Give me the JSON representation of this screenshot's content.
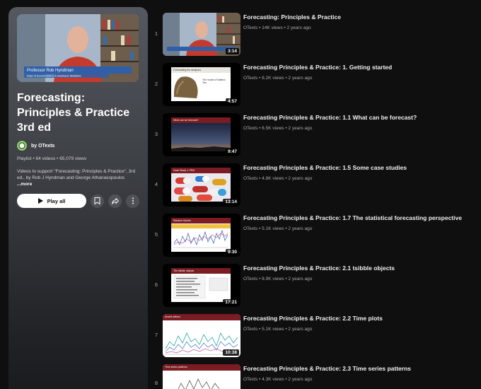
{
  "playlist": {
    "thumb_caption_line1": "Professor Rob Hyndman",
    "thumb_caption_line2": "Dept of Econometrics & Business Statistics",
    "title": "Forecasting: Principles & Practice 3rd ed",
    "owner": "by OTexts",
    "stats": "Playlist • 64 videos • 65,079 views",
    "description": "Videos to support \"Forecasting: Principles & Practice\", 3rd ed., by Rob J Hyndman and George Athanasopoulos",
    "more_label": "...more",
    "play_all_label": "Play all"
  },
  "videos": [
    {
      "index": "1",
      "title": "Forecasting: Principles & Practice",
      "meta": "OTexts • 14K views • 2 years ago",
      "duration": "3:14"
    },
    {
      "index": "2",
      "title": "Forecasting Principles & Practice: 1. Getting started",
      "meta": "OTexts • 8.2K views • 2 years ago",
      "duration": "4:57",
      "slide_title": "Forecasting the weapons",
      "slide_text": "The model of Watts's Tea"
    },
    {
      "index": "3",
      "title": "Forecasting Principles & Practice: 1.1 What can be forecast?",
      "meta": "OTexts • 6.5K views • 2 years ago",
      "duration": "9:47",
      "slide_title": "What can we forecast?"
    },
    {
      "index": "4",
      "title": "Forecasting Principles & Practice: 1.5 Some case studies",
      "meta": "OTexts • 4.8K views • 2 years ago",
      "duration": "13:14",
      "slide_title": "Case Study 1: PBS"
    },
    {
      "index": "5",
      "title": "Forecasting Principles & Practice: 1.7 The statistical forecasting perspective",
      "meta": "OTexts • 5.1K views • 2 years ago",
      "duration": "9:30",
      "slide_title": "Random futures"
    },
    {
      "index": "6",
      "title": "Forecasting Principles & Practice: 2.1 tsibble objects",
      "meta": "OTexts • 8.9K views • 2 years ago",
      "duration": "17:21",
      "slide_title": "The tsibble objects"
    },
    {
      "index": "7",
      "title": "Forecasting Principles & Practice: 2.2 Time plots",
      "meta": "OTexts • 5.1K views • 2 years ago",
      "duration": "10:38",
      "slide_title": "Ansett airlines"
    },
    {
      "index": "8",
      "title": "Forecasting Principles & Practice: 2.3 Time series patterns",
      "meta": "OTexts • 4.3K views • 2 years ago",
      "duration": "",
      "slide_title": "Time series patterns"
    }
  ],
  "colors": {
    "background": "#0f0f0f",
    "slide_header": "#7a1c22",
    "accent_red": "#c0392b"
  }
}
